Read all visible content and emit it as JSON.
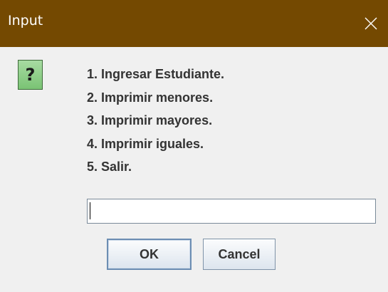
{
  "window": {
    "title": "Input",
    "titlebar_color": "#744901"
  },
  "icon": {
    "name": "question-icon",
    "glyph": "?"
  },
  "menu": {
    "items": [
      "1. Ingresar Estudiante.",
      "2. Imprimir menores.",
      "3. Imprimir mayores.",
      "4. Imprimir iguales.",
      "5. Salir."
    ]
  },
  "input": {
    "value": "",
    "placeholder": ""
  },
  "buttons": {
    "ok_label": "OK",
    "cancel_label": "Cancel"
  }
}
